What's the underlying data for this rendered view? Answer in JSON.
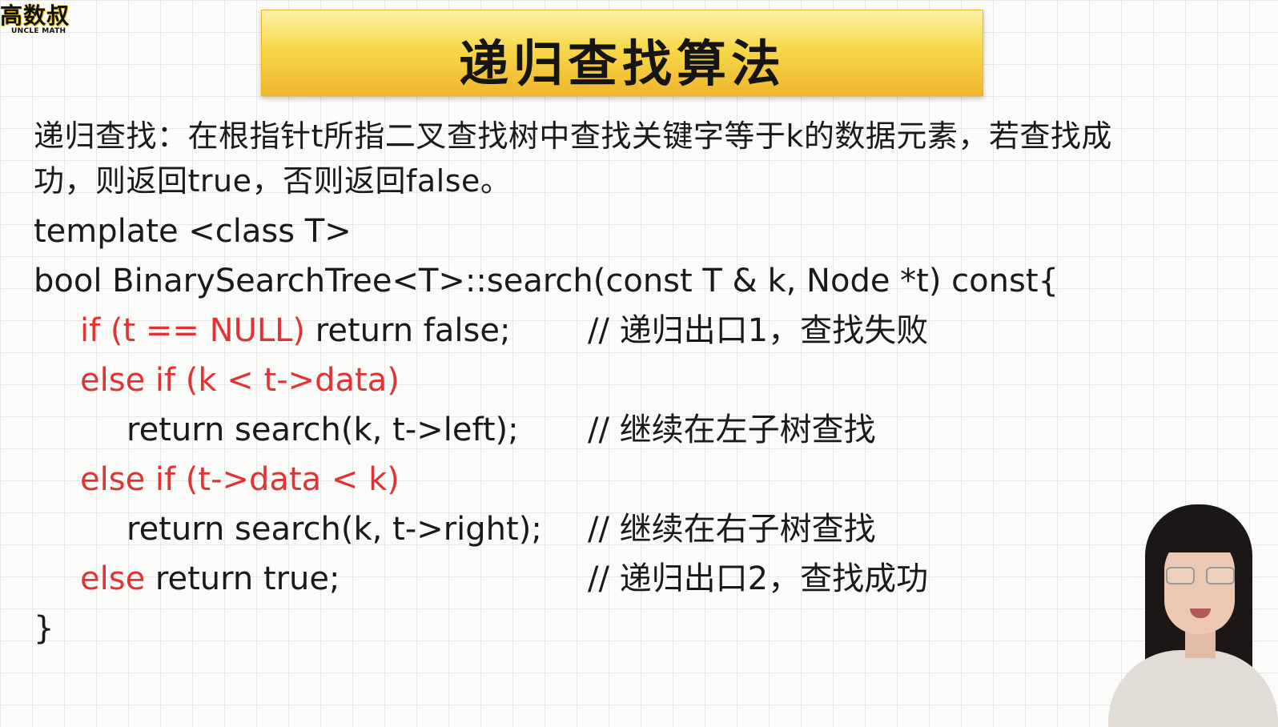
{
  "logo": {
    "text_cn": "高数叔",
    "text_en": "UNCLE MATH"
  },
  "title": "递归查找算法",
  "description": {
    "line1": "递归查找：在根指针t所指二叉查找树中查找关键字等于k的数据元素，若查找成",
    "line2": "功，则返回true，否则返回false。"
  },
  "code": {
    "line1": "template <class T>",
    "line2": "bool BinarySearchTree<T>::search(const T & k, Node *t) const{",
    "line3_red": "if (t == NULL)",
    "line3_rest": " return false;",
    "line3_comment": "// 递归出口1，查找失败",
    "line4_red": "else if (k < t->data)",
    "line5": "return search(k, t->left);",
    "line5_comment": "// 继续在左子树查找",
    "line6_red": "else if (t->data < k)",
    "line7": "return search(k, t->right);",
    "line7_comment": "// 继续在右子树查找",
    "line8_red": "else",
    "line8_rest": "  return true;",
    "line8_comment": "// 递归出口2，查找成功",
    "line9": "}"
  },
  "colors": {
    "banner": "#f8d84a",
    "keyword_red": "#e03434",
    "text": "#1a1a1a"
  },
  "icons": {
    "presenter": "presenter-video-icon"
  }
}
